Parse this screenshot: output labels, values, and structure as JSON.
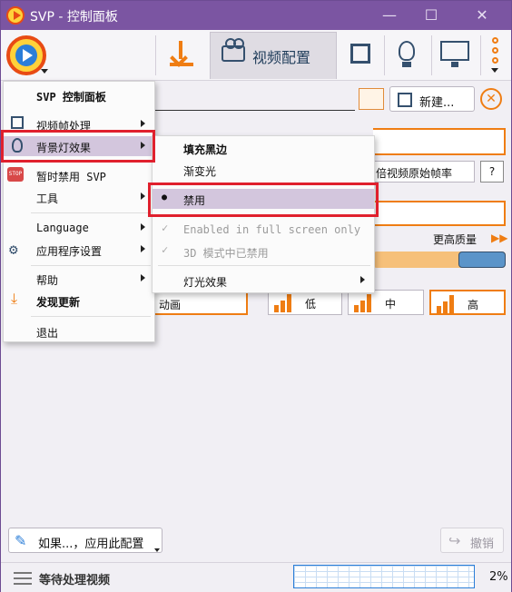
{
  "window": {
    "title": "SVP - 控制面板",
    "buttons": {
      "minimize": "—",
      "maximize": "☐",
      "close": "✕"
    }
  },
  "toolbar": {
    "video_config_label": "视频配置",
    "icons": [
      "download-icon",
      "video-camera-icon",
      "crop-icon",
      "lightbulb-icon",
      "monitor-icon",
      "more-icon"
    ]
  },
  "background": {
    "new_button": "新建...",
    "fps_text": "倍视频原始帧率",
    "help_label": "?",
    "quality_label": "更高质量",
    "animation_label": "动画",
    "quality_options": [
      "低",
      "中",
      "高"
    ],
    "close_symbol": "✕"
  },
  "main_menu": {
    "items": [
      {
        "label": "SVP 控制面板",
        "bold": true
      },
      {
        "label": "视频帧处理",
        "submenu": true
      },
      {
        "label": "背景灯效果",
        "submenu": true,
        "highlighted": true
      },
      {
        "label": "暂时禁用 SVP"
      },
      {
        "label": "工具",
        "submenu": true
      },
      {
        "label": "Language",
        "submenu": true
      },
      {
        "label": "应用程序设置",
        "submenu": true
      },
      {
        "label": "帮助",
        "submenu": true
      },
      {
        "label": "发现更新",
        "bold": true
      },
      {
        "label": "退出"
      }
    ]
  },
  "sub_menu": {
    "items": [
      {
        "label": "填充黑边",
        "bold": true
      },
      {
        "label": "渐变光"
      },
      {
        "label": "禁用",
        "selected": true
      },
      {
        "label": "Enabled in full screen only",
        "disabled": true,
        "checked": true
      },
      {
        "label": "3D 模式中已禁用",
        "disabled": true,
        "checked": true
      },
      {
        "label": "灯光效果",
        "submenu": true
      }
    ]
  },
  "bottom": {
    "apply_label": "如果...，应用此配置",
    "undo_label": "撤销"
  },
  "status": {
    "text": "等待处理视频",
    "percent": "2%"
  },
  "colors": {
    "title_bar": "#7b55a2",
    "accent": "#ef7d13",
    "highlight": "#d3c6dd",
    "annotation": "#e0202d"
  }
}
